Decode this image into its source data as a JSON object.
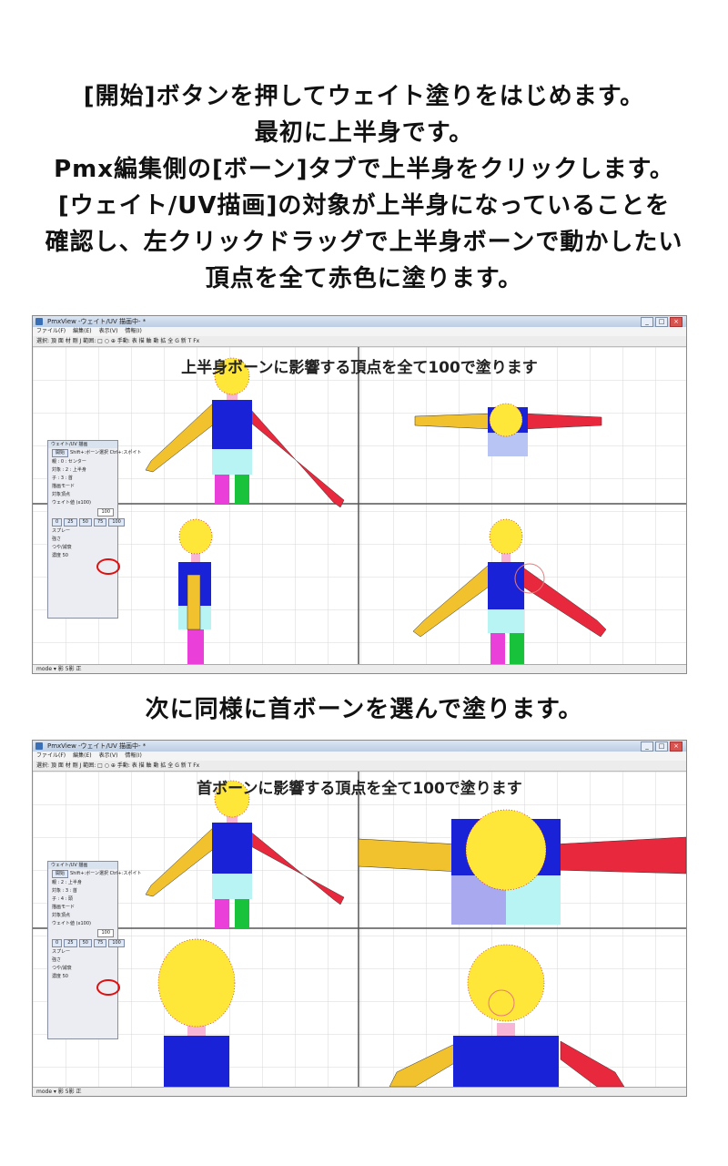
{
  "intro_lines": [
    "[開始]ボタンを押してウェイト塗りをはじめます。",
    "最初に上半身です。",
    "Pmx編集側の[ボーン]タブで上半身をクリックします。",
    "[ウェイト/UV描画]の対象が上半身になっていることを",
    "確認し、左クリックドラッグで上半身ボーンで動かしたい",
    "頂点を全て赤色に塗ります。"
  ],
  "caption_between": "次に同様に首ボーンを選んで塗ります。",
  "window": {
    "title": "PmxView -ウェイト/UV 描画中- *",
    "menu": [
      "ファイル(F)",
      "編集(E)",
      "表示(V)",
      "情報(I)"
    ],
    "toolbar_text": "選択: 頂 面 材 剛 J   範囲: □ ○ ⊕   手動: 表 描 軸 動 拡 全 G 新 T   Fx",
    "status_text": "mode ▾  影 5影 正",
    "buttons": {
      "min": "_",
      "max": "□",
      "close": "×"
    }
  },
  "screens": [
    {
      "overlay_text": "上半身ボーンに影響する頂点を全て100で塗ります",
      "panel": {
        "title": "ウェイト/UV 描画",
        "start_btn": "開始",
        "hint": "Shift+:ボーン選択 Ctrl+:スポイト",
        "parent_line": "親 : 0 : センター",
        "target_line": "対象 : 2 : 上半身",
        "child_line": "子 : 3 : 首",
        "draw_mode": "描画モード",
        "target_vertex": "対象頂点",
        "weight_label": "ウェイト値 (x100)",
        "weight_value": "100",
        "presets": [
          "0",
          "25",
          "50",
          "75",
          "100"
        ],
        "spray": "スプレー",
        "strength": "強さ",
        "options": "つや/減衰",
        "density": "濃度 50"
      }
    },
    {
      "overlay_text": "首ボーンに影響する頂点を全て100で塗ります",
      "panel": {
        "title": "ウェイト/UV 描画",
        "start_btn": "開始",
        "hint": "Shift+:ボーン選択 Ctrl+:スポイト",
        "parent_line": "親 : 2 : 上半身",
        "target_line": "対象 : 3 : 首",
        "child_line": "子 : 4 : 頭",
        "draw_mode": "描画モード",
        "target_vertex": "対象頂点",
        "weight_label": "ウェイト値 (x100)",
        "weight_value": "100",
        "presets": [
          "0",
          "25",
          "50",
          "75",
          "100"
        ],
        "spray": "スプレー",
        "strength": "強さ",
        "options": "つや/減衰",
        "density": "濃度 50"
      }
    }
  ],
  "colors": {
    "head": "#ffe73a",
    "left_arm": "#f2c12e",
    "right_arm": "#e8283c",
    "torso": "#1a22d8",
    "hips": "#b8f4f4",
    "left_leg": "#ea3fd9",
    "right_leg": "#18c23a",
    "grid": "#d7d7d7",
    "divider": "#555555",
    "accent_red": "#dd1111"
  }
}
